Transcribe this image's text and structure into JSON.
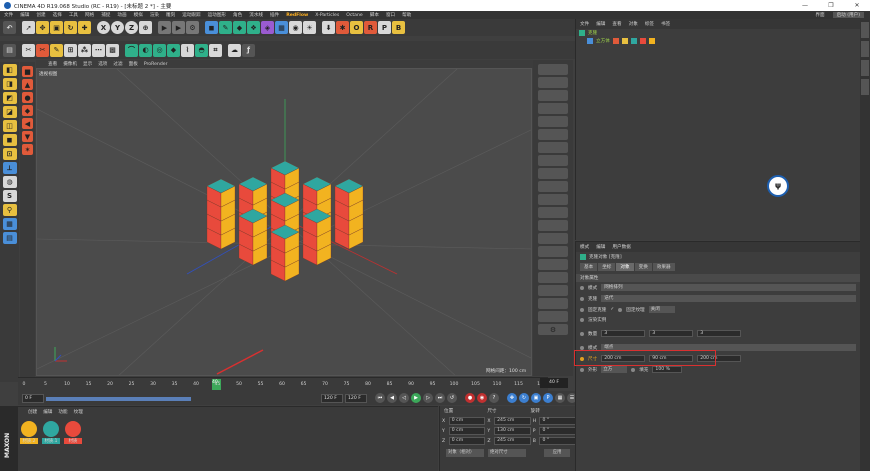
{
  "window": {
    "title": "CINEMA 4D R19.068 Studio (RC - R19) - [未标题 2 *] - 主要",
    "min": "—",
    "restore": "❐",
    "close": "✕"
  },
  "menubar": {
    "items": [
      "文件",
      "编辑",
      "创建",
      "选择",
      "工具",
      "网格",
      "捕捉",
      "动画",
      "模拟",
      "渲染",
      "雕刻",
      "运动跟踪",
      "运动图形",
      "角色",
      "流水线",
      "插件",
      "RedFlow",
      "X-Particles",
      "Octane",
      "脚本",
      "窗口",
      "帮助"
    ],
    "layout_label": "界面",
    "layout_value": "启动 (用户)"
  },
  "viewport": {
    "menu": [
      "查看",
      "摄像机",
      "显示",
      "选项",
      "过滤",
      "面板",
      "ProRender"
    ],
    "label": "透视视图",
    "grid_info": "网格间距：100 cm"
  },
  "timeline": {
    "ticks": [
      "0",
      "5",
      "10",
      "15",
      "20",
      "25",
      "30",
      "35",
      "40",
      "45",
      "50",
      "55",
      "60",
      "65",
      "70",
      "75",
      "80",
      "85",
      "90",
      "95",
      "100",
      "105",
      "110",
      "115",
      "12"
    ],
    "current": "40",
    "end_frame": "40 F"
  },
  "transport": {
    "start": "0 F",
    "range_end": "120 F",
    "max": "120 F"
  },
  "materials": {
    "menu": [
      "创建",
      "编辑",
      "功能",
      "纹理"
    ],
    "items": [
      {
        "name": "材质.2",
        "color": "#f2b320"
      },
      {
        "name": "材质.1",
        "color": "#2fa7a0"
      },
      {
        "name": "材质",
        "color": "#e84a3c"
      }
    ]
  },
  "coords": {
    "headers": [
      "位置",
      "尺寸",
      "旋转"
    ],
    "rows": [
      {
        "axis": "X",
        "pos": "0 cm",
        "size_axis": "X",
        "size": "245 cm",
        "rot_axis": "H",
        "rot": "0 °"
      },
      {
        "axis": "Y",
        "pos": "0 cm",
        "size_axis": "Y",
        "size": "130 cm",
        "rot_axis": "P",
        "rot": "0 °"
      },
      {
        "axis": "Z",
        "pos": "0 cm",
        "size_axis": "Z",
        "size": "245 cm",
        "rot_axis": "B",
        "rot": "0 °"
      }
    ],
    "mode": "对象（相对）",
    "size_mode": "绝对尺寸",
    "apply": "应用"
  },
  "objmgr": {
    "menu": [
      "文件",
      "编辑",
      "查看",
      "对象",
      "标签",
      "书签"
    ],
    "objects": [
      {
        "name": "克隆",
        "indent": 0
      },
      {
        "name": "立方体",
        "indent": 1
      }
    ]
  },
  "attr": {
    "menu": [
      "模式",
      "编辑",
      "用户数据"
    ],
    "title": "克隆对象 [克隆]",
    "tabs": [
      "基本",
      "坐标",
      "对象",
      "变换",
      "效果器"
    ],
    "active_tab": "对象",
    "section": "对象属性",
    "mode_label": "模式",
    "mode_value": "网格排列",
    "clones_label": "克隆",
    "clones_value": "迭代",
    "fix_clone": "固定克隆",
    "fix_texture": "固定纹理",
    "fix_texture_value": "关闭",
    "render_instances": "渲染实例",
    "count_label": "数量",
    "count": [
      "3",
      "3",
      "3"
    ],
    "mode2_label": "模式",
    "mode2_value": "端点",
    "size_label": "尺寸",
    "size": [
      "200 cm",
      "90 cm",
      "200 cm"
    ],
    "shape_label": "外形",
    "shape_value": "立方",
    "fill_label": "填充",
    "fill_value": "100 %"
  },
  "logo_text": "ψ"
}
